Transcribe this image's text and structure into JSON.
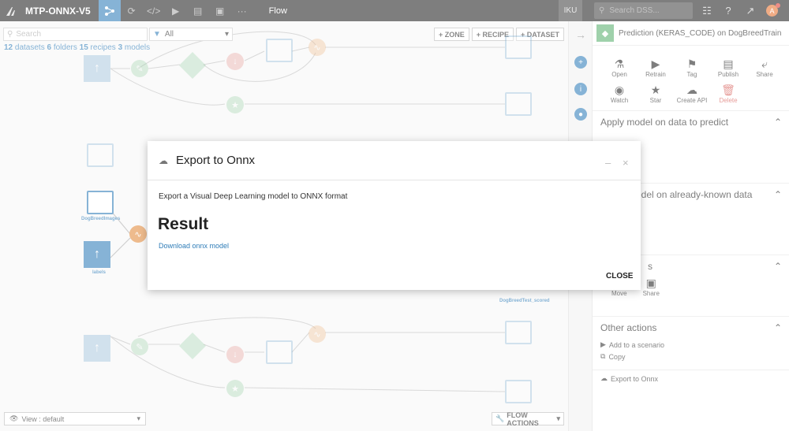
{
  "topbar": {
    "project_name": "MTP-ONNX-V5",
    "flow_label": "Flow",
    "iku_label": "IKU",
    "search_placeholder": "Search DSS...",
    "avatar_letter": "A"
  },
  "flow": {
    "search_placeholder": "Search",
    "filter_value": "All",
    "summary": {
      "datasets_count": "12",
      "datasets_label": "datasets",
      "folders_count": "6",
      "folders_label": "folders",
      "recipes_count": "15",
      "recipes_label": "recipes",
      "models_count": "3",
      "models_label": "models"
    },
    "add_zone": "+ ZONE",
    "add_recipe": "+ RECIPE",
    "add_dataset": "+ DATASET",
    "view_label": "View : default",
    "flow_actions_label": "FLOW ACTIONS",
    "node_labels": {
      "dog_breed_images": "DogBreedImages",
      "labels": "labels",
      "dog_breed_test_scored": "DogBreedTest_scored"
    }
  },
  "panel": {
    "title": "Prediction (KERAS_CODE) on DogBreedTrain",
    "actions": [
      {
        "label": "Open",
        "icon": "flask-icon"
      },
      {
        "label": "Retrain",
        "icon": "play-icon"
      },
      {
        "label": "Tag",
        "icon": "tag-icon"
      },
      {
        "label": "Publish",
        "icon": "publish-icon"
      },
      {
        "label": "Share",
        "icon": "share-icon"
      },
      {
        "label": "Watch",
        "icon": "eye-icon"
      },
      {
        "label": "Star",
        "icon": "star-icon"
      },
      {
        "label": "Create API",
        "icon": "cloud-icon"
      },
      {
        "label": "Delete",
        "icon": "trash-icon"
      }
    ],
    "section_apply": "Apply model on data to predict",
    "section_evaluate": "odel on already-known data",
    "section_other_partial": "s",
    "move_label": "Move",
    "share_label": "Share",
    "other_actions_title": "Other actions",
    "add_to_scenario": "Add to a scenario",
    "copy": "Copy",
    "export_to_onnx": "Export to Onnx"
  },
  "modal": {
    "title": "Export to Onnx",
    "description": "Export a Visual Deep Learning model to ONNX format",
    "result_heading": "Result",
    "download_link": "Download onnx model",
    "close_label": "CLOSE"
  },
  "colors": {
    "accent": "#2f7db8",
    "model_green": "#5ab06f",
    "danger": "#d4534e",
    "recipe_orange": "#e28a3b"
  }
}
